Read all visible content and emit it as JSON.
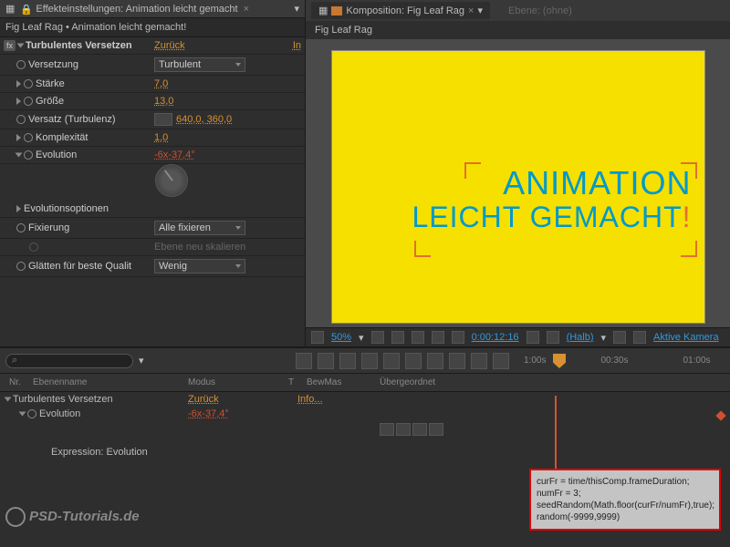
{
  "panel": {
    "title": "Effekteinstellungen: Animation leicht gemacht",
    "breadcrumb": "Fig Leaf Rag • Animation leicht gemacht!"
  },
  "effect": {
    "name": "Turbulentes Versetzen",
    "reset": "Zurück",
    "info": "In",
    "props": {
      "versetzung": {
        "label": "Versetzung",
        "value": "Turbulent"
      },
      "staerke": {
        "label": "Stärke",
        "value": "7,0"
      },
      "groesse": {
        "label": "Größe",
        "value": "13,0"
      },
      "versatz": {
        "label": "Versatz (Turbulenz)",
        "value": "640,0, 360,0"
      },
      "komplex": {
        "label": "Komplexität",
        "value": "1,0"
      },
      "evolution": {
        "label": "Evolution",
        "value": "-6x-37,4°"
      },
      "evopts": {
        "label": "Evolutionsoptionen"
      },
      "fixierung": {
        "label": "Fixierung",
        "value": "Alle fixieren"
      },
      "ebene": {
        "label": "Ebene neu skalieren"
      },
      "glaetten": {
        "label": "Glätten für beste Qualit",
        "value": "Wenig"
      }
    }
  },
  "comp": {
    "tab1": "Komposition: Fig Leaf Rag",
    "tab2": "Ebene: (ohne)",
    "subtab": "Fig Leaf Rag"
  },
  "canvas": {
    "line1": "ANIMATION",
    "line2": "LEICHT GEMACHT",
    "excl": "!"
  },
  "viewport_bar": {
    "zoom": "50%",
    "timecode": "0:00:12:16",
    "mode": "(Halb)",
    "camera": "Aktive Kamera"
  },
  "timeline": {
    "headers": {
      "nr": "Nr.",
      "name": "Ebenenname",
      "modus": "Modus",
      "t": "T",
      "bewmas": "BewMas",
      "ueber": "Übergeordnet"
    },
    "row1": {
      "name": "Turbulentes Versetzen",
      "modus": "Zurück",
      "info": "Info..."
    },
    "row2": {
      "name": "Evolution",
      "value": "-6x-37,4°"
    },
    "row3": {
      "name": "Expression: Evolution"
    },
    "times": {
      "t0": "1:00s",
      "t1": "00:30s",
      "t2": "01:00s"
    }
  },
  "expression": {
    "l1": "curFr = time/thisComp.frameDuration;",
    "l2": "numFr = 3;",
    "l3": "seedRandom(Math.floor(curFr/numFr),true);",
    "l4": "random(-9999,9999)"
  },
  "watermark": "PSD-Tutorials.de"
}
